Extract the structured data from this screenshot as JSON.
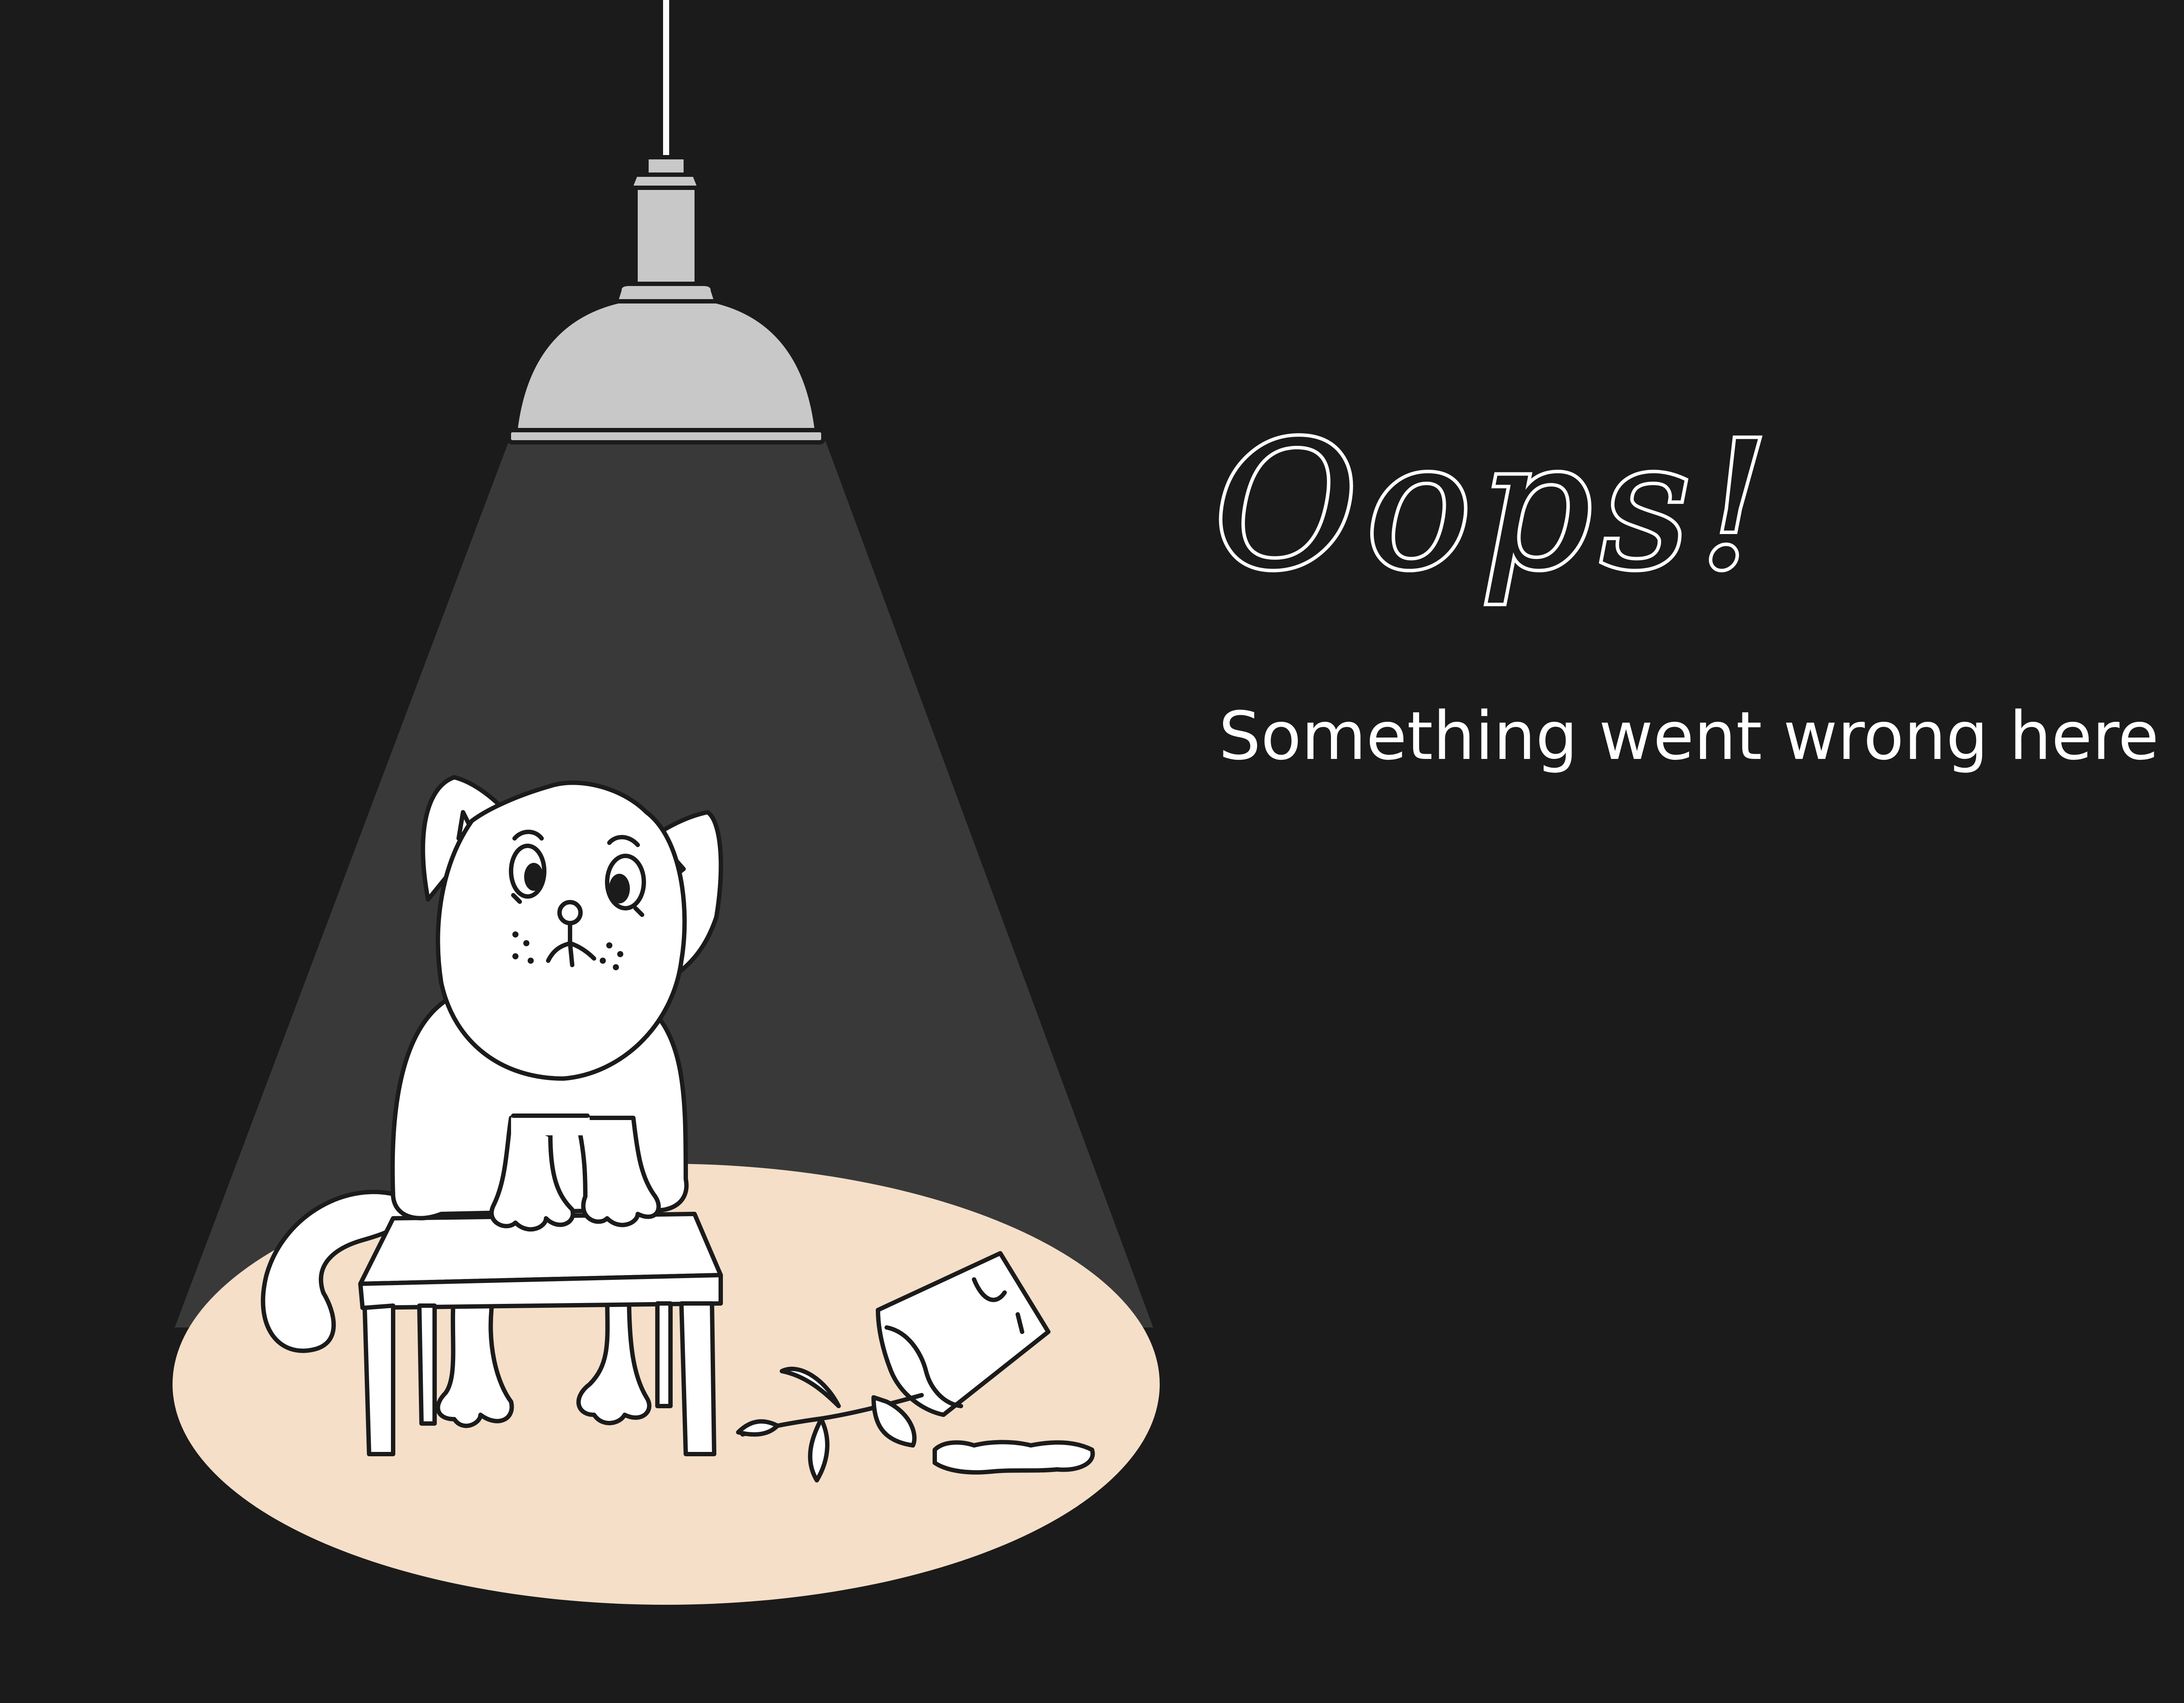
{
  "message": {
    "heading": "Oops!",
    "subheading": "Something went wrong here"
  },
  "illustration": {
    "subjects": [
      "ceiling-lamp",
      "light-beam",
      "cat",
      "stool",
      "spilled-flower-pot"
    ]
  },
  "colors": {
    "background": "#1b1b1b",
    "beam": "#393939",
    "floor_light": "#f5dfc9",
    "lamp": "#c8c8c8",
    "outline": "#1b1b1b",
    "fill": "#ffffff",
    "text": "#ffffff"
  }
}
